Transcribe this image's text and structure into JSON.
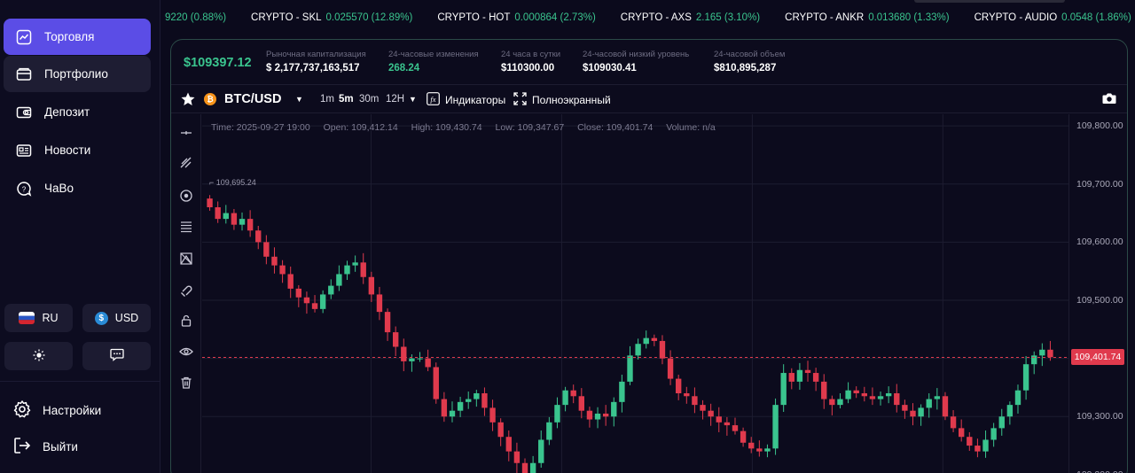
{
  "sidebar": {
    "nav": [
      {
        "label": "Торговля",
        "icon": "chart-line-icon"
      },
      {
        "label": "Портфолио",
        "icon": "wallet-icon"
      },
      {
        "label": "Депозит",
        "icon": "deposit-icon"
      },
      {
        "label": "Новости",
        "icon": "news-icon"
      },
      {
        "label": "ЧаВо",
        "icon": "faq-icon"
      }
    ],
    "language": "RU",
    "currency": "USD",
    "currency_symbol": "$",
    "settings_label": "Настройки",
    "logout_label": "Выйти"
  },
  "ticker": [
    {
      "name": "",
      "value": "9220 (0.88%)"
    },
    {
      "name": "CRYPTO - SKL",
      "value": "0.025570 (12.89%)"
    },
    {
      "name": "CRYPTO - HOT",
      "value": "0.000864 (2.73%)"
    },
    {
      "name": "CRYPTO - AXS",
      "value": "2.165 (3.10%)"
    },
    {
      "name": "CRYPTO - ANKR",
      "value": "0.013680 (1.33%)"
    },
    {
      "name": "CRYPTO - AUDIO",
      "value": "0.0548 (1.86%)"
    }
  ],
  "stats": {
    "price": "$109397.12",
    "market_cap_label": "Рыночная капитализация",
    "market_cap": "$ 2,177,737,163,517",
    "change_label": "24-часовые изменения",
    "change": "268.24",
    "high_label": "24 часа в сутки",
    "high": "$110300.00",
    "low_label": "24-часовой низкий уровень",
    "low": "$109030.41",
    "volume_label": "24-часовой объем",
    "volume": "$810,895,287"
  },
  "toolbar": {
    "symbol": "BTC/USD",
    "coin_glyph": "₿",
    "timeframes": [
      "1m",
      "5m",
      "30m",
      "12H"
    ],
    "active_timeframe": "5m",
    "indicators_label": "Индикаторы",
    "fullscreen_label": "Полноэкранный"
  },
  "ohlc": {
    "time": "Time: 2025-09-27 19:00",
    "open": "Open: 109,412.14",
    "high": "High: 109,430.74",
    "low": "Low: 109,347.67",
    "close": "Close: 109,401.74",
    "volume": "Volume: n/a"
  },
  "chart_data": {
    "type": "candlestick",
    "y_ticks": [
      "109,800.00",
      "109,700.00",
      "109,600.00",
      "109,500.00",
      "109,400.00",
      "109,300.00",
      "109,200.00"
    ],
    "ylim": [
      109180,
      109820
    ],
    "current_price": "109,401.74",
    "max_label": "109,695.24",
    "closes": [
      109660,
      109640,
      109650,
      109630,
      109640,
      109620,
      109600,
      109575,
      109560,
      109545,
      109520,
      109505,
      109495,
      109485,
      109510,
      109525,
      109545,
      109560,
      109565,
      109540,
      109510,
      109480,
      109445,
      109420,
      109395,
      109400,
      109400,
      109385,
      109330,
      109300,
      109310,
      109325,
      109330,
      109340,
      109315,
      109290,
      109265,
      109240,
      109220,
      109195,
      109220,
      109260,
      109290,
      109320,
      109345,
      109335,
      109310,
      109295,
      109305,
      109300,
      109325,
      109360,
      109405,
      109425,
      109435,
      109430,
      109400,
      109365,
      109340,
      109335,
      109320,
      109310,
      109300,
      109290,
      109285,
      109275,
      109255,
      109245,
      109240,
      109245,
      109320,
      109375,
      109360,
      109380,
      109375,
      109360,
      109330,
      109320,
      109330,
      109345,
      109340,
      109335,
      109330,
      109335,
      109340,
      109320,
      109310,
      109300,
      109315,
      109330,
      109335,
      109300,
      109280,
      109265,
      109250,
      109240,
      109260,
      109280,
      109300,
      109320,
      109345,
      109390,
      109405,
      109415,
      109402
    ]
  }
}
